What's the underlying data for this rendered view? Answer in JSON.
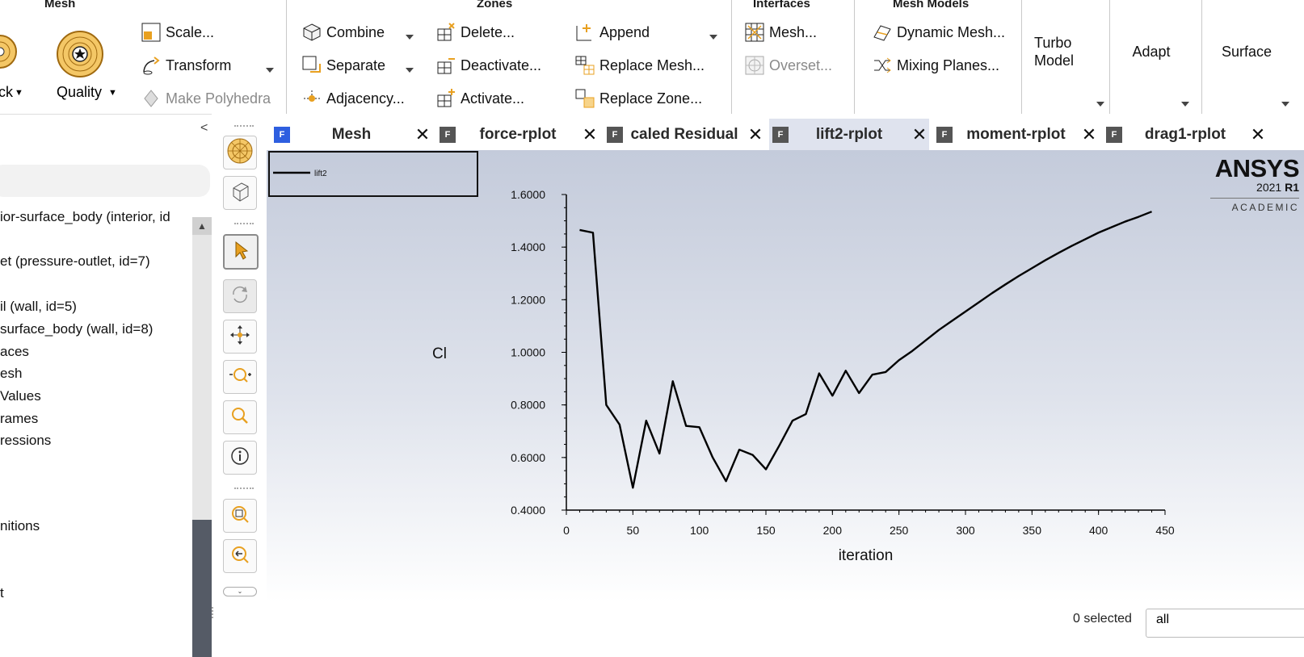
{
  "ribbon": {
    "groups": {
      "mesh": "Mesh",
      "zones": "Zones",
      "interfaces": "Interfaces",
      "mesh_models": "Mesh Models"
    },
    "mesh": {
      "check_label": "ck",
      "quality_label": "Quality",
      "scale_label": "Scale...",
      "transform_label": "Transform",
      "make_polyhedra_label": "Make Polyhedra"
    },
    "zones": {
      "combine": "Combine",
      "separate": "Separate",
      "adjacency": "Adjacency...",
      "delete": "Delete...",
      "deactivate": "Deactivate...",
      "activate": "Activate...",
      "append": "Append",
      "replace_mesh": "Replace Mesh...",
      "replace_zone": "Replace Zone..."
    },
    "interfaces": {
      "mesh": "Mesh...",
      "overset": "Overset..."
    },
    "mesh_models": {
      "dynamic_mesh": "Dynamic Mesh...",
      "mixing_planes": "Mixing Planes..."
    },
    "turbo_model": "Turbo\nModel",
    "adapt": "Adapt",
    "surface": "Surface"
  },
  "outline": {
    "collapse_glyph": "<",
    "items": [
      "ior-surface_body (interior, id",
      "et (pressure-outlet, id=7)",
      "il (wall, id=5)",
      "surface_body (wall, id=8)",
      "aces",
      "esh",
      "Values",
      "rames",
      "ressions",
      "nitions",
      "t"
    ]
  },
  "tabs": [
    {
      "label": "Mesh",
      "icon": "F",
      "active": false
    },
    {
      "label": "force-rplot",
      "icon": "F",
      "active": false
    },
    {
      "label": "caled Residual",
      "icon": "F",
      "active": false
    },
    {
      "label": "lift2-rplot",
      "icon": "F",
      "active": true
    },
    {
      "label": "moment-rplot",
      "icon": "F",
      "active": false
    },
    {
      "label": "drag1-rplot",
      "icon": "F",
      "active": false
    }
  ],
  "tab_close_glyph": "✕",
  "logo": {
    "brand": "ANSYS",
    "version": "2021",
    "release": "R1",
    "edition": "ACADEMIC"
  },
  "statusbar": {
    "selected_text": "0 selected",
    "filter_value": "all"
  },
  "colors": {
    "tab_active_bg": "#dfe3ee",
    "plot_bg_top": "#c4cbdb",
    "line": "#000000",
    "ficon_blue": "#2e5fe0",
    "scroll_thumb": "#555b66"
  },
  "chart_data": {
    "type": "line",
    "title": "",
    "xlabel": "iteration",
    "ylabel": "Cl",
    "xlim": [
      0,
      450
    ],
    "ylim": [
      0.4,
      1.6
    ],
    "xticks": [
      "0",
      "50",
      "100",
      "150",
      "200",
      "250",
      "300",
      "350",
      "400",
      "450"
    ],
    "yticks": [
      "0.4000",
      "0.6000",
      "0.8000",
      "1.0000",
      "1.2000",
      "1.4000",
      "1.6000"
    ],
    "legend_position": "top-left",
    "grid": false,
    "series": [
      {
        "name": "lift2",
        "x": [
          10,
          20,
          30,
          40,
          50,
          60,
          70,
          80,
          90,
          100,
          110,
          120,
          130,
          140,
          150,
          160,
          170,
          180,
          190,
          200,
          210,
          220,
          230,
          240,
          250,
          260,
          270,
          280,
          290,
          300,
          310,
          320,
          330,
          340,
          350,
          360,
          370,
          380,
          390,
          400,
          410,
          420,
          430,
          440
        ],
        "y": [
          1.465,
          1.455,
          0.8,
          0.725,
          0.485,
          0.74,
          0.615,
          0.89,
          0.72,
          0.715,
          0.6,
          0.51,
          0.63,
          0.61,
          0.555,
          0.645,
          0.74,
          0.765,
          0.92,
          0.835,
          0.93,
          0.845,
          0.915,
          0.925,
          0.97,
          1.005,
          1.045,
          1.085,
          1.12,
          1.155,
          1.19,
          1.225,
          1.258,
          1.29,
          1.32,
          1.35,
          1.378,
          1.405,
          1.43,
          1.455,
          1.476,
          1.497,
          1.515,
          1.535
        ]
      }
    ]
  }
}
